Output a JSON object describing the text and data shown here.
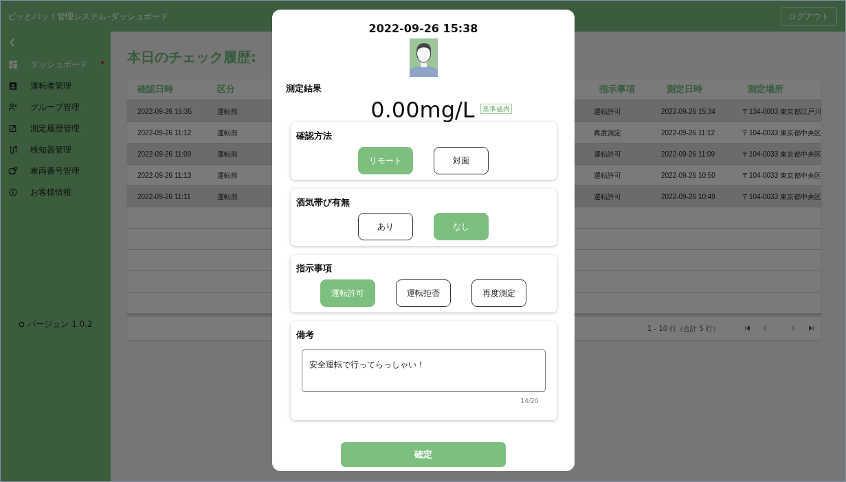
{
  "header": {
    "title": "ピッとパッ！管理システム–ダッシュボード",
    "logout": "ログアウト"
  },
  "sidebar": {
    "items": [
      {
        "label": "ダッシュボード",
        "selected": true,
        "notification": true
      },
      {
        "label": "運転者管理",
        "selected": false,
        "notification": false
      },
      {
        "label": "グループ管理",
        "selected": false,
        "notification": false
      },
      {
        "label": "測定履歴管理",
        "selected": false,
        "notification": false
      },
      {
        "label": "検知器管理",
        "selected": false,
        "notification": false
      },
      {
        "label": "車両番号管理",
        "selected": false,
        "notification": false
      },
      {
        "label": "お客様情報",
        "selected": false,
        "notification": false
      }
    ],
    "version": "バージョン 1.0.2"
  },
  "main": {
    "heading": "本日のチェック履歴:",
    "table": {
      "columns": [
        "確認日時",
        "区分",
        "指示事項",
        "測定日時",
        "測定場所"
      ],
      "rows": [
        [
          "2022-09-26 15:35",
          "運転前",
          "運転許可",
          "2022-09-26 15:34",
          "〒134-0003 東京都江戸川"
        ],
        [
          "2022-09-26 11:12",
          "運転前",
          "再度測定",
          "2022-09-26 11:12",
          "〒104-0033 東京都中央区"
        ],
        [
          "2022-09-26 11:09",
          "運転前",
          "運転許可",
          "2022-09-26 11:09",
          "〒104-0033 東京都中央区"
        ],
        [
          "2022-09-26 11:13",
          "運転前",
          "運転許可",
          "2022-09-26 10:50",
          "〒104-0033 東京都中央区"
        ],
        [
          "2022-09-26 11:11",
          "運転前",
          "運転許可",
          "2022-09-26 10:49",
          "〒104-0033 東京都中央区"
        ]
      ],
      "pagination": "1 - 10 行（合計 5 行）"
    }
  },
  "dialog": {
    "datetime": "2022-09-26 15:38",
    "result_label": "測定結果",
    "result_value": "0.00mg/L",
    "result_badge": "基準値内",
    "groups": [
      {
        "label": "確認方法",
        "options": [
          {
            "label": "リモート",
            "selected": true
          },
          {
            "label": "対面",
            "selected": false
          }
        ]
      },
      {
        "label": "酒気帯び有無",
        "options": [
          {
            "label": "あり",
            "selected": false
          },
          {
            "label": "なし",
            "selected": true
          }
        ]
      },
      {
        "label": "指示事項",
        "options": [
          {
            "label": "運転許可",
            "selected": true
          },
          {
            "label": "運転拒否",
            "selected": false
          },
          {
            "label": "再度測定",
            "selected": false
          }
        ]
      }
    ],
    "remarks": {
      "label": "備考",
      "value": "安全運転で行ってらっしゃい！",
      "counter": "14/20"
    },
    "confirm": "確定"
  }
}
